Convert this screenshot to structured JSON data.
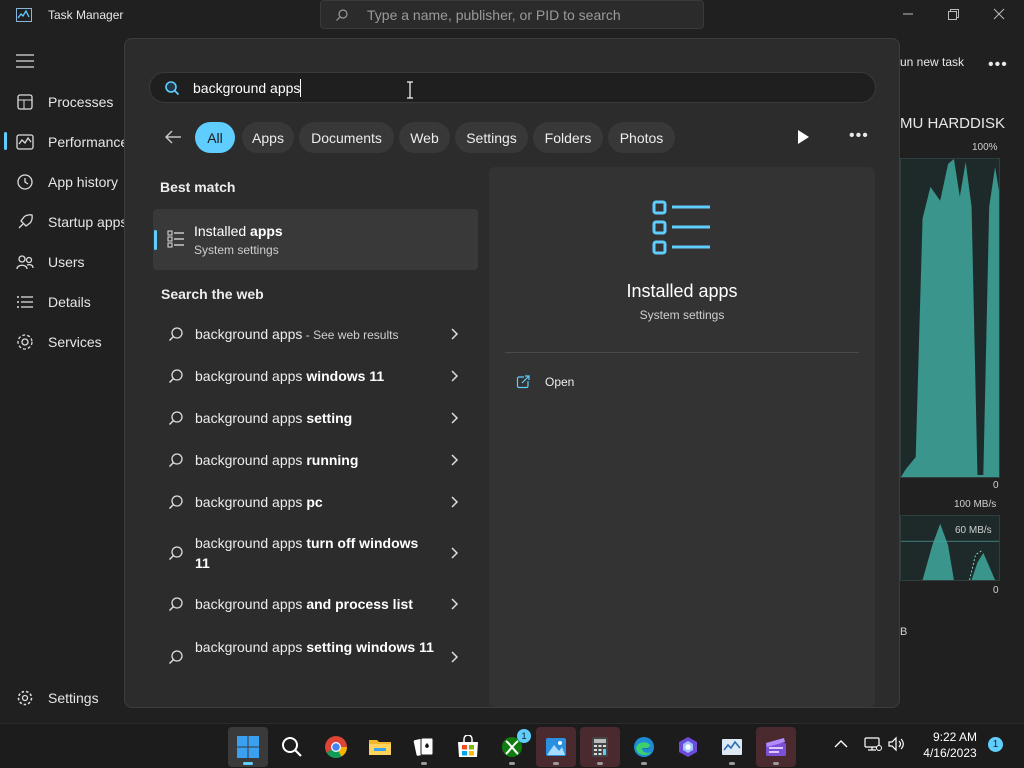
{
  "task_manager": {
    "title": "Task Manager",
    "search_placeholder": "Type a name, publisher, or PID to search",
    "nav": [
      {
        "label": "Processes",
        "icon": "processes-icon"
      },
      {
        "label": "Performance",
        "icon": "performance-icon",
        "selected": true
      },
      {
        "label": "App history",
        "icon": "app-history-icon"
      },
      {
        "label": "Startup apps",
        "icon": "startup-apps-icon"
      },
      {
        "label": "Users",
        "icon": "users-icon"
      },
      {
        "label": "Details",
        "icon": "details-icon"
      },
      {
        "label": "Services",
        "icon": "services-icon"
      }
    ],
    "settings_label": "Settings",
    "run_new_task": "un new task",
    "disk_label": "MU HARDDISK",
    "disk_max": "100%",
    "disk_min": "0",
    "rate_max": "100 MB/s",
    "rate_mid": "60 MB/s",
    "rate_min": "0",
    "unit_partial": "B"
  },
  "search": {
    "query": "background apps",
    "filters": [
      "All",
      "Apps",
      "Documents",
      "Web",
      "Settings",
      "Folders",
      "Photos"
    ],
    "active_filter": "All",
    "best_match_heading": "Best match",
    "best_match": {
      "title_plain": "Installed ",
      "title_bold": "apps",
      "subtitle": "System settings"
    },
    "web_heading": "Search the web",
    "web_results": [
      {
        "plain": "background apps",
        "bold": "",
        "suffix": " - See web results"
      },
      {
        "plain": "background apps ",
        "bold": "windows 11",
        "suffix": ""
      },
      {
        "plain": "background apps ",
        "bold": "setting",
        "suffix": ""
      },
      {
        "plain": "background apps ",
        "bold": "running",
        "suffix": ""
      },
      {
        "plain": "background apps ",
        "bold": "pc",
        "suffix": ""
      },
      {
        "plain": "background apps ",
        "bold": "turn off windows 11",
        "suffix": ""
      },
      {
        "plain": "background apps ",
        "bold": "and process list",
        "suffix": ""
      },
      {
        "plain": "background apps ",
        "bold": "setting windows 11",
        "suffix": ""
      }
    ],
    "preview": {
      "title": "Installed apps",
      "subtitle": "System settings",
      "action": "Open"
    }
  },
  "taskbar": {
    "apps": [
      "start",
      "search",
      "chrome",
      "file-explorer",
      "solitaire",
      "store",
      "xbox",
      "photos",
      "calculator",
      "edge",
      "copilot",
      "task-manager",
      "clipchamp"
    ],
    "xbox_badge": "1",
    "clock_time": "9:22 AM",
    "clock_date": "4/16/2023",
    "notification_count": "1"
  },
  "colors": {
    "accent": "#60cdff",
    "graph": "#3fa89d"
  }
}
